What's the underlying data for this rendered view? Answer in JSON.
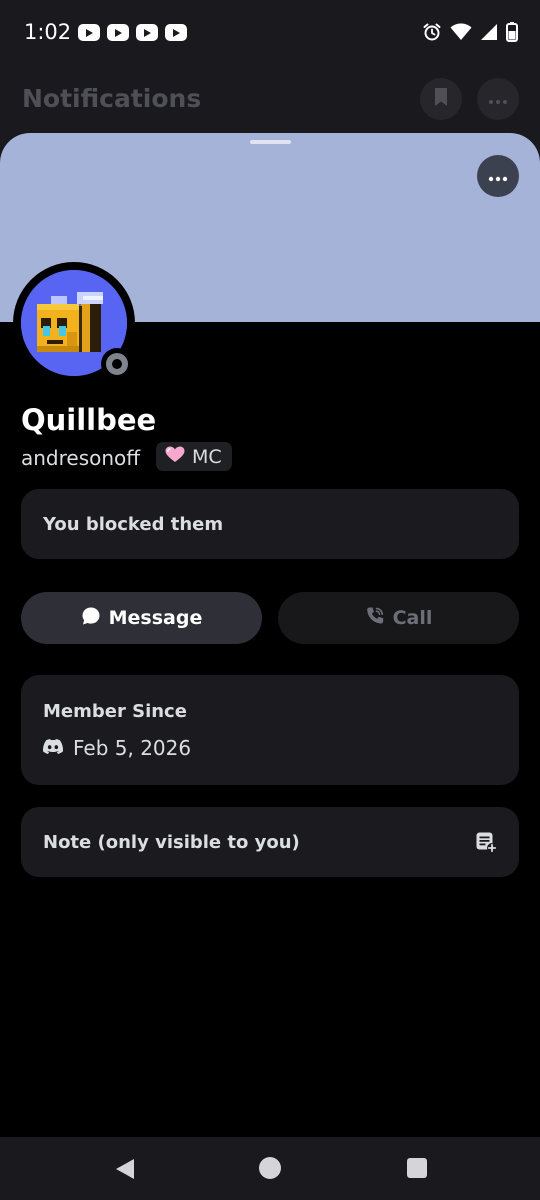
{
  "status_bar": {
    "time": "1:02",
    "notification_icons": [
      "youtube-icon",
      "youtube-icon",
      "youtube-icon",
      "youtube-icon"
    ],
    "system_icons": [
      "alarm-icon",
      "wifi-icon",
      "signal-icon",
      "battery-icon"
    ]
  },
  "background_header": {
    "title": "Notifications",
    "icons": [
      "bookmark-icon",
      "more-icon"
    ]
  },
  "profile": {
    "banner_color": "#a5b3d8",
    "avatar_color": "#5865f2",
    "presence_status": "offline",
    "display_name": "Quillbee",
    "username": "andresonoff",
    "server_tag": {
      "icon": "pink-heart-icon",
      "label": "MC"
    },
    "blocked_notice": "You blocked them",
    "actions": {
      "message_label": "Message",
      "call_label": "Call"
    },
    "member_since": {
      "title": "Member Since",
      "icon": "discord-icon",
      "date": "Feb 5, 2026"
    },
    "note": {
      "label": "Note (only visible to you)",
      "icon": "add-note-icon"
    }
  },
  "nav_bar": {
    "icons": [
      "back-icon",
      "home-icon",
      "recents-icon"
    ]
  },
  "colors": {
    "accent": "#5865f2",
    "sheet_background": "#000000",
    "card_background": "#1b1b1f"
  }
}
